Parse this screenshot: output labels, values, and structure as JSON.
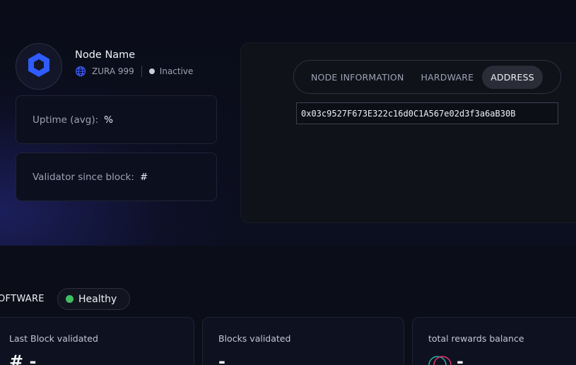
{
  "node": {
    "name": "Node Name",
    "network": "ZURA 999",
    "status": "Inactive",
    "uptime_label": "Uptime (avg):",
    "uptime_value": "%",
    "validator_label": "Validator since block:",
    "validator_value": "#"
  },
  "tabs": [
    {
      "label": "NODE INFORMATION",
      "active": false
    },
    {
      "label": "HARDWARE",
      "active": false
    },
    {
      "label": "ADDRESS",
      "active": true
    }
  ],
  "address": "0x03c9527F673E322c16d0C1A567e02d3f3a6aB30B",
  "software": {
    "label": "OFTWARE",
    "health": "Healthy",
    "health_color": "#3fbf5f"
  },
  "cards": [
    {
      "label": "Last Block validated",
      "value": "# -"
    },
    {
      "label": "Blocks validated",
      "value": "-"
    },
    {
      "label": "total rewards balance",
      "value": "-"
    }
  ],
  "colors": {
    "brand": "#2f5bff",
    "background": "#080a14"
  },
  "icons": {
    "node_logo": "hexagon-logo-icon",
    "network": "globe-icon",
    "status": "status-dot-icon",
    "reward_token": "token-icon"
  }
}
